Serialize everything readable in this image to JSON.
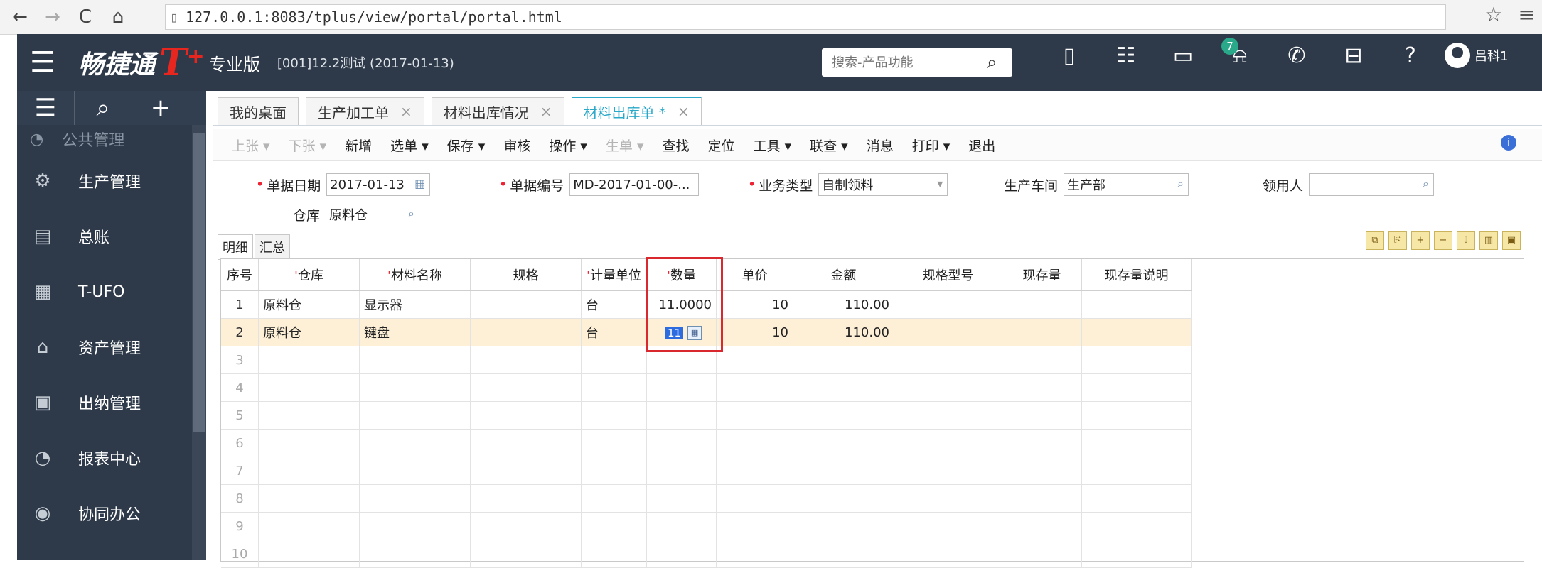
{
  "browser": {
    "url": "127.0.0.1:8083/tplus/view/portal/portal.html",
    "nav_icons": [
      "back-icon",
      "forward-icon",
      "reload-icon",
      "home-icon"
    ]
  },
  "header": {
    "brand": "畅捷通",
    "brand_mark": "T",
    "edition": "专业版",
    "account": "[001]12.2测试  (2017-01-13)",
    "search_placeholder": "搜索-产品功能",
    "notification_count": "7",
    "user": "吕科1"
  },
  "sidebar": {
    "partial_item": "公共管理",
    "items": [
      {
        "label": "生产管理",
        "icon": "factory-icon"
      },
      {
        "label": "总账",
        "icon": "ledger-icon"
      },
      {
        "label": "T-UFO",
        "icon": "report-sheet-icon"
      },
      {
        "label": "资产管理",
        "icon": "asset-icon"
      },
      {
        "label": "出纳管理",
        "icon": "cashier-icon"
      },
      {
        "label": "报表中心",
        "icon": "pie-chart-icon"
      },
      {
        "label": "协同办公",
        "icon": "collab-icon"
      }
    ]
  },
  "tabs": [
    {
      "label": "我的桌面",
      "closable": false
    },
    {
      "label": "生产加工单",
      "closable": true
    },
    {
      "label": "材料出库情况",
      "closable": true
    },
    {
      "label": "材料出库单 *",
      "closable": true,
      "active": true
    }
  ],
  "toolbar": {
    "items": [
      {
        "label": "上张 ▾",
        "enabled": false
      },
      {
        "label": "下张 ▾",
        "enabled": false
      },
      {
        "label": "新增",
        "enabled": true
      },
      {
        "label": "选单 ▾",
        "enabled": true
      },
      {
        "label": "保存 ▾",
        "enabled": true
      },
      {
        "label": "审核",
        "enabled": true
      },
      {
        "label": "操作 ▾",
        "enabled": true
      },
      {
        "label": "生单 ▾",
        "enabled": false
      },
      {
        "label": "查找",
        "enabled": true
      },
      {
        "label": "定位",
        "enabled": true
      },
      {
        "label": "工具 ▾",
        "enabled": true
      },
      {
        "label": "联查 ▾",
        "enabled": true
      },
      {
        "label": "消息",
        "enabled": true
      },
      {
        "label": "打印 ▾",
        "enabled": true
      },
      {
        "label": "退出",
        "enabled": true
      }
    ]
  },
  "form": {
    "date_label": "单据日期",
    "date_value": "2017-01-13",
    "code_label": "单据编号",
    "code_value": "MD-2017-01-00-...",
    "biz_type_label": "业务类型",
    "biz_type_value": "自制领料",
    "workshop_label": "生产车间",
    "workshop_value": "生产部",
    "receiver_label": "领用人",
    "receiver_value": "",
    "warehouse_label": "仓库",
    "warehouse_value": "原料仓"
  },
  "subtabs": [
    "明细",
    "汇总"
  ],
  "grid": {
    "columns": [
      "序号",
      "仓库",
      "材料名称",
      "规格",
      "计量单位",
      "数量",
      "单价",
      "金额",
      "规格型号",
      "现存量",
      "现存量说明"
    ],
    "required_columns": [
      1,
      2,
      4,
      5
    ],
    "rows": [
      {
        "idx": "1",
        "warehouse": "原料仓",
        "name": "显示器",
        "spec": "",
        "unit": "台",
        "qty": "11.0000",
        "price": "10",
        "amount": "110.00"
      },
      {
        "idx": "2",
        "warehouse": "原料仓",
        "name": "键盘",
        "spec": "",
        "unit": "台",
        "qty": "11",
        "price": "10",
        "amount": "110.00"
      }
    ],
    "empty_rows": [
      "3",
      "4",
      "5",
      "6",
      "7",
      "8",
      "9",
      "10"
    ]
  },
  "colors": {
    "nav_bg": "#2e3a4a",
    "accent": "#2aa8c7",
    "brand_red": "#e6261f",
    "highlight_red": "#d9282e",
    "selected_row": "#fdf0d7"
  }
}
